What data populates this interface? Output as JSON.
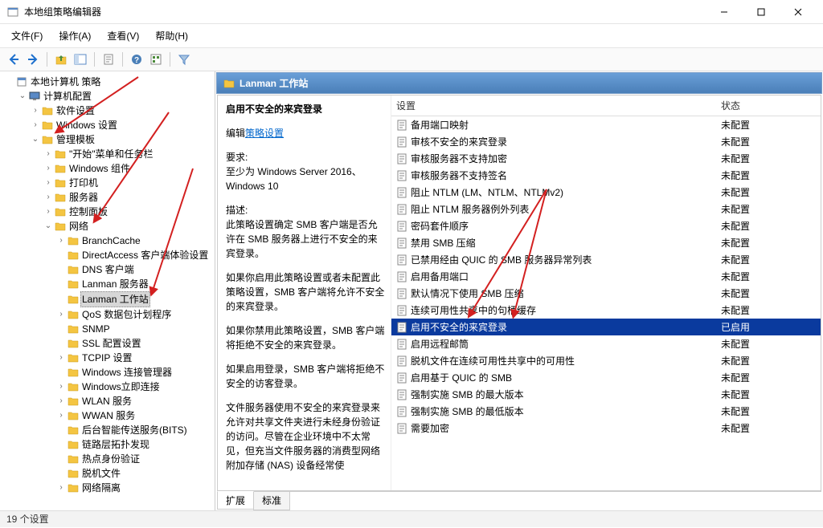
{
  "window": {
    "title": "本地组策略编辑器"
  },
  "menubar": {
    "file": "文件(F)",
    "action": "操作(A)",
    "view": "查看(V)",
    "help": "帮助(H)"
  },
  "tree": {
    "root": "本地计算机 策略",
    "computer": "计算机配置",
    "software": "软件设置",
    "windows_settings": "Windows 设置",
    "admin_templates": "管理模板",
    "start_menu": "\"开始\"菜单和任务栏",
    "win_components": "Windows 组件",
    "printers": "打印机",
    "servers": "服务器",
    "control_panel": "控制面板",
    "network": "网络",
    "branchcache": "BranchCache",
    "directaccess": "DirectAccess 客户端体验设置",
    "dns_client": "DNS 客户端",
    "lanman_server": "Lanman 服务器",
    "lanman_workstation": "Lanman 工作站",
    "qos": "QoS 数据包计划程序",
    "snmp": "SNMP",
    "ssl": "SSL 配置设置",
    "tcpip": "TCPIP 设置",
    "conn_mgr": "Windows 连接管理器",
    "win_now": "Windows立即连接",
    "wlan": "WLAN 服务",
    "wwan": "WWAN 服务",
    "bits": "后台智能传送服务(BITS)",
    "lltd": "链路层拓扑发现",
    "hotspot": "热点身份验证",
    "offline": "脱机文件",
    "isolation": "网络隔离"
  },
  "panel": {
    "header": "Lanman 工作站"
  },
  "detail": {
    "title": "启用不安全的来宾登录",
    "edit_prefix": "编辑",
    "edit_link": "策略设置",
    "req_label": "要求:",
    "req_text": "至少为 Windows Server 2016、Windows 10",
    "desc_label": "描述:",
    "desc1": "此策略设置确定 SMB 客户端是否允许在 SMB 服务器上进行不安全的来宾登录。",
    "desc2": "如果你启用此策略设置或者未配置此策略设置，SMB 客户端将允许不安全的来宾登录。",
    "desc3": "如果你禁用此策略设置，SMB 客户端将拒绝不安全的来宾登录。",
    "desc4": "如果启用登录，SMB 客户端将拒绝不安全的访客登录。",
    "desc5": "文件服务器使用不安全的来宾登录来允许对共享文件夹进行未经身份验证的访问。尽管在企业环境中不太常见，但充当文件服务器的消费型网络附加存储 (NAS) 设备经常使"
  },
  "columns": {
    "setting": "设置",
    "state": "状态"
  },
  "states": {
    "not_configured": "未配置",
    "enabled": "已启用"
  },
  "settings": [
    {
      "name": "备用端口映射",
      "state": "未配置"
    },
    {
      "name": "审核不安全的来宾登录",
      "state": "未配置"
    },
    {
      "name": "审核服务器不支持加密",
      "state": "未配置"
    },
    {
      "name": "审核服务器不支持签名",
      "state": "未配置"
    },
    {
      "name": "阻止 NTLM (LM、NTLM、NTLMv2)",
      "state": "未配置"
    },
    {
      "name": "阻止 NTLM 服务器例外列表",
      "state": "未配置"
    },
    {
      "name": "密码套件顺序",
      "state": "未配置"
    },
    {
      "name": "禁用 SMB 压缩",
      "state": "未配置"
    },
    {
      "name": "已禁用经由 QUIC 的 SMB 服务器异常列表",
      "state": "未配置"
    },
    {
      "name": "启用备用端口",
      "state": "未配置"
    },
    {
      "name": "默认情况下使用 SMB 压缩",
      "state": "未配置"
    },
    {
      "name": "连续可用性共享中的句柄缓存",
      "state": "未配置"
    },
    {
      "name": "启用不安全的来宾登录",
      "state": "已启用",
      "selected": true
    },
    {
      "name": "启用远程邮筒",
      "state": "未配置"
    },
    {
      "name": "脱机文件在连续可用性共享中的可用性",
      "state": "未配置"
    },
    {
      "name": "启用基于 QUIC 的 SMB",
      "state": "未配置"
    },
    {
      "name": "强制实施 SMB 的最大版本",
      "state": "未配置"
    },
    {
      "name": "强制实施 SMB 的最低版本",
      "state": "未配置"
    },
    {
      "name": "需要加密",
      "state": "未配置"
    }
  ],
  "tabs": {
    "extended": "扩展",
    "standard": "标准"
  },
  "statusbar": "19 个设置"
}
